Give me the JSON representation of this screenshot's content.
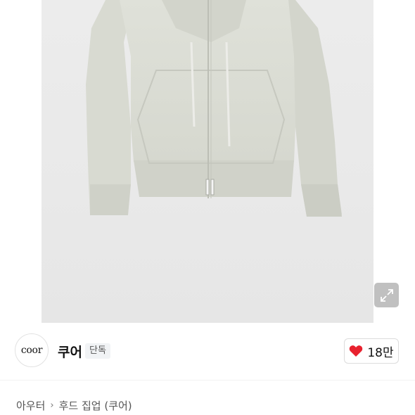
{
  "product_image": {
    "alt": "",
    "expand_icon": "expand-arrows-icon"
  },
  "brand": {
    "logo_text": "coor",
    "name": "쿠어",
    "badge": "단독"
  },
  "like": {
    "icon": "heart-icon",
    "count": "18만",
    "color": "#e8212e"
  },
  "breadcrumb": {
    "category": "아우터",
    "separator_icon": "chevron-right-icon",
    "subcategory": "후드 집업 (쿠어)"
  }
}
